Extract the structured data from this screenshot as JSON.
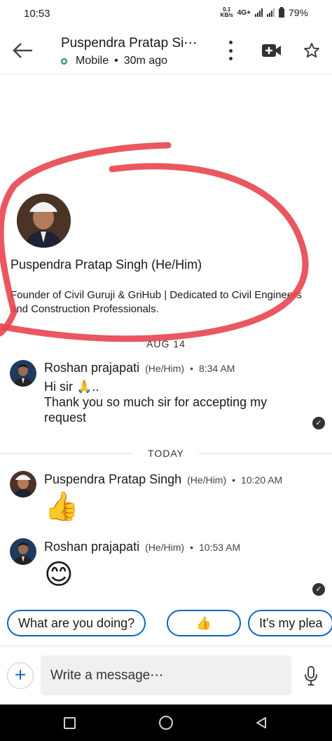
{
  "status_bar": {
    "time": "10:53",
    "speed_value": "0.1",
    "speed_unit": "KB/s",
    "network": "4G+",
    "battery": "79%"
  },
  "header": {
    "name": "Puspendra Pratap Si⋯",
    "status": "Mobile",
    "last_seen": "30m ago",
    "icons": [
      "back-arrow-icon",
      "more-vertical-icon",
      "video-call-icon",
      "star-icon"
    ]
  },
  "profile": {
    "name": "Puspendra Pratap Singh (He/Him)",
    "headline": "Founder of Civil Guruji & GriHub | Dedicated to Civil Engineers and Construction Professionals."
  },
  "separators": {
    "first": "AUG 14",
    "second": "TODAY"
  },
  "messages": [
    {
      "sender": "Roshan prajapati",
      "pronouns": "(He/Him)",
      "time": "8:34 AM",
      "line1": "Hi sir 🙏..",
      "line2": "Thank you so much sir for accepting my",
      "line3": "request"
    },
    {
      "sender": "Puspendra Pratap Singh",
      "pronouns": "(He/Him)",
      "time": "10:20 AM",
      "emoji": "👍"
    },
    {
      "sender": "Roshan prajapati",
      "pronouns": "(He/Him)",
      "time": "10:53 AM",
      "emoji": "😊"
    }
  ],
  "suggestions": [
    "What are you doing?",
    "👍",
    "It's my plea"
  ],
  "composer": {
    "placeholder": "Write a message⋯",
    "plus": "+"
  },
  "colors": {
    "accent": "#0a66c2",
    "annotation": "#e8454f",
    "online": "#2e8b57"
  }
}
